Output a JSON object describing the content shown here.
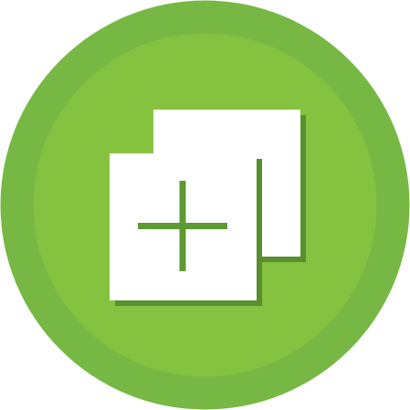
{
  "icon": {
    "name": "add-duplicate-icon",
    "colors": {
      "outer_ring": "#76B843",
      "inner_circle": "#85C240",
      "square": "#FFFFFF",
      "shadow": "#5B8E2F",
      "plus": "#5E9A33"
    }
  }
}
